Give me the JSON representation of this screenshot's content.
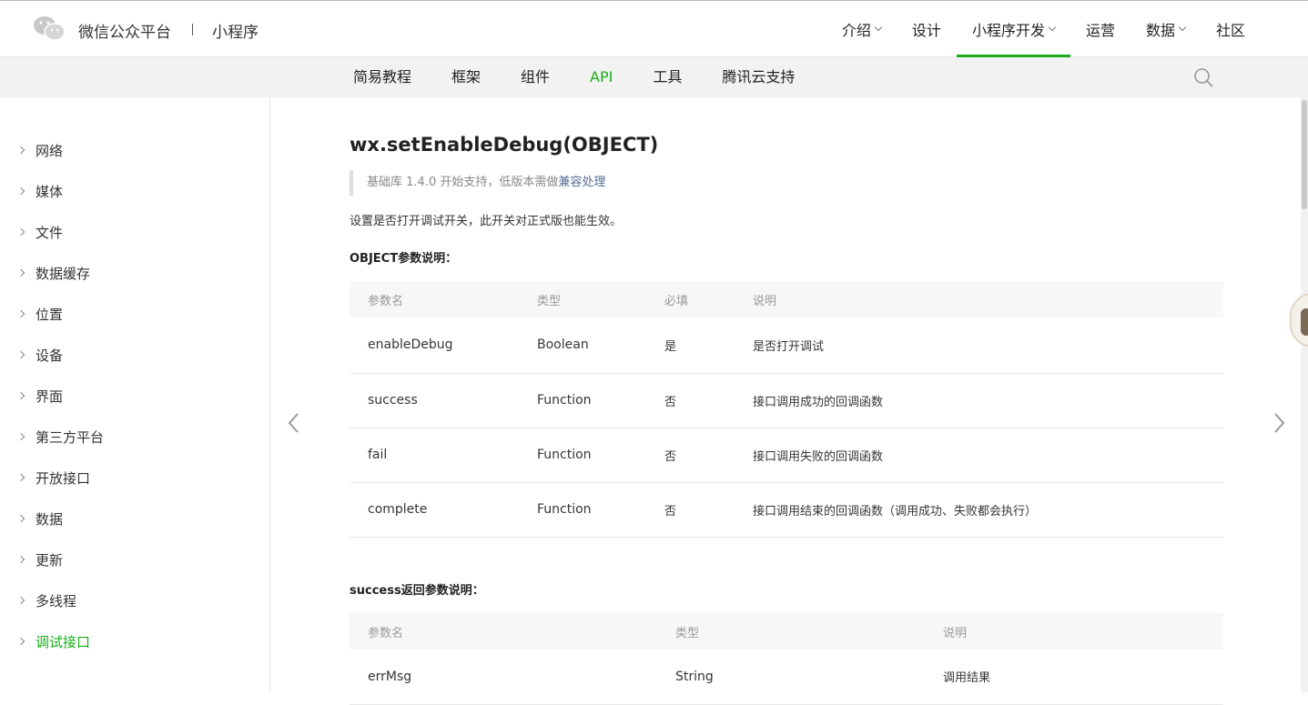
{
  "header": {
    "brand": "微信公众平台",
    "section": "小程序",
    "nav": [
      {
        "label": "介绍",
        "dropdown": true
      },
      {
        "label": "设计",
        "dropdown": false
      },
      {
        "label": "小程序开发",
        "dropdown": true,
        "active": true
      },
      {
        "label": "运营",
        "dropdown": false
      },
      {
        "label": "数据",
        "dropdown": true
      },
      {
        "label": "社区",
        "dropdown": false
      }
    ]
  },
  "subnav": {
    "items": [
      "简易教程",
      "框架",
      "组件",
      "API",
      "工具",
      "腾讯云支持"
    ],
    "active": "API",
    "search_icon": "search-icon"
  },
  "sidebar": {
    "items": [
      "网络",
      "媒体",
      "文件",
      "数据缓存",
      "位置",
      "设备",
      "界面",
      "第三方平台",
      "开放接口",
      "数据",
      "更新",
      "多线程",
      "调试接口"
    ],
    "active": "调试接口"
  },
  "content": {
    "title": "wx.setEnableDebug(OBJECT)",
    "note_prefix": "基础库 1.4.0 开始支持，低版本需做",
    "note_link": "兼容处理",
    "description": "设置是否打开调试开关，此开关对正式版也能生效。",
    "object_section_title": "OBJECT参数说明：",
    "object_table": {
      "headers": [
        "参数名",
        "类型",
        "必填",
        "说明"
      ],
      "rows": [
        [
          "enableDebug",
          "Boolean",
          "是",
          "是否打开调试"
        ],
        [
          "success",
          "Function",
          "否",
          "接口调用成功的回调函数"
        ],
        [
          "fail",
          "Function",
          "否",
          "接口调用失败的回调函数"
        ],
        [
          "complete",
          "Function",
          "否",
          "接口调用结束的回调函数（调用成功、失败都会执行）"
        ]
      ]
    },
    "success_section_title": "success返回参数说明：",
    "success_table": {
      "headers": [
        "参数名",
        "类型",
        "说明"
      ],
      "rows": [
        [
          "errMsg",
          "String",
          "调用结果"
        ]
      ]
    }
  },
  "colors": {
    "accent": "#1aad19",
    "link": "#576b95"
  }
}
